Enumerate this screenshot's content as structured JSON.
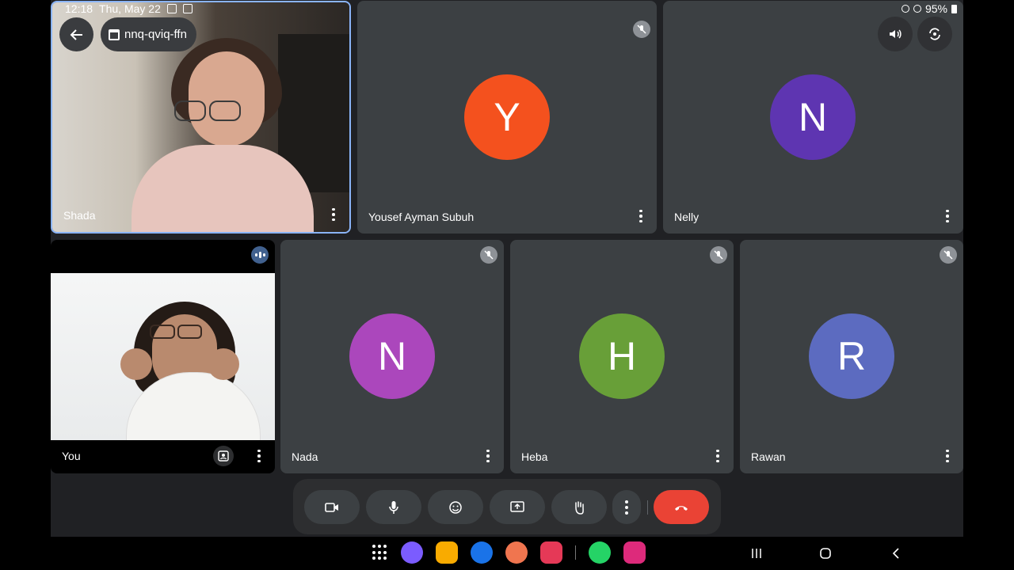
{
  "status": {
    "time": "12:18",
    "date": "Thu, May 22",
    "battery": "95%"
  },
  "meeting": {
    "code": "nnq-qviq-ffn"
  },
  "participants": [
    {
      "name": "Shada"
    },
    {
      "name": "Yousef Ayman Subuh",
      "initial": "Y",
      "color": "#f4511e"
    },
    {
      "name": "Nelly",
      "initial": "N",
      "color": "#5e35b1"
    },
    {
      "name": "You"
    },
    {
      "name": "Nada",
      "initial": "N",
      "color": "#ab47bc"
    },
    {
      "name": "Heba",
      "initial": "H",
      "color": "#689f38"
    },
    {
      "name": "Rawan",
      "initial": "R",
      "color": "#5c6bc0"
    }
  ],
  "controls": [
    "camera-icon",
    "microphone-icon",
    "emoji-icon",
    "present-screen-icon",
    "raise-hand-icon",
    "more-options-icon",
    "end-call-icon"
  ],
  "taskbar_apps": [
    {
      "name": "browser-app-icon",
      "color": "#7b5cff"
    },
    {
      "name": "files-app-icon",
      "color": "#f9ab00"
    },
    {
      "name": "messages-app-icon",
      "color": "#1a73e8"
    },
    {
      "name": "contacts-app-icon",
      "color": "#f0754f"
    },
    {
      "name": "camera-app-icon",
      "color": "#e53957"
    },
    {
      "name": "whatsapp-app-icon",
      "color": "#25d366"
    },
    {
      "name": "instagram-app-icon",
      "color": "#dd2a7b"
    }
  ]
}
